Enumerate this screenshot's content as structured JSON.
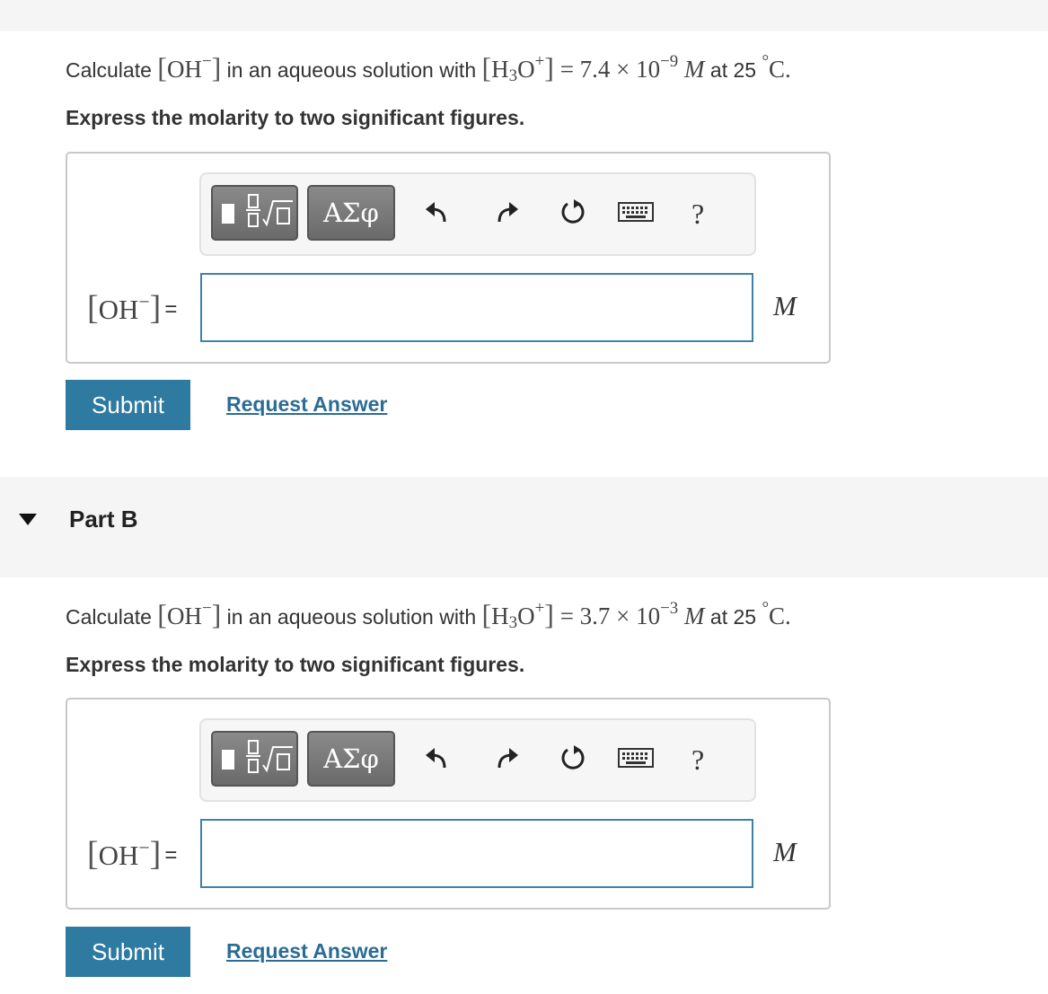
{
  "partA": {
    "question": {
      "prefix": "Calculate",
      "species": "OH",
      "middle": "in an aqueous solution with",
      "acid_h": "H",
      "acid_sub": "3",
      "acid_o": "O",
      "equals": "=",
      "mantissa": "7.4",
      "times": "×",
      "base": "10",
      "exponent": "−9",
      "molar": "M",
      "at": "at 25",
      "degree": "°",
      "celsius": "C."
    },
    "instruction": "Express the molarity to two significant figures.",
    "answer_label": "OH",
    "answer_equals": "=",
    "answer_value": "",
    "unit": "M",
    "submit_label": "Submit",
    "request_label": "Request Answer"
  },
  "partB": {
    "title": "Part B",
    "question": {
      "prefix": "Calculate",
      "species": "OH",
      "middle": "in an aqueous solution with",
      "acid_h": "H",
      "acid_sub": "3",
      "acid_o": "O",
      "equals": "=",
      "mantissa": "3.7",
      "times": "×",
      "base": "10",
      "exponent": "−3",
      "molar": "M",
      "at": "at 25",
      "degree": "°",
      "celsius": "C."
    },
    "instruction": "Express the molarity to two significant figures.",
    "answer_label": "OH",
    "answer_equals": "=",
    "answer_value": "",
    "unit": "M",
    "submit_label": "Submit",
    "request_label": "Request Answer"
  },
  "toolbar": {
    "greek_label": "ΑΣφ",
    "help_label": "?",
    "icons": [
      "templates-icon",
      "greek-symbols-icon",
      "undo-icon",
      "redo-icon",
      "reset-icon",
      "keyboard-icon",
      "help-icon"
    ]
  },
  "colors": {
    "accent": "#2f7aa0",
    "link": "#2b6c96",
    "input_border": "#3e82a8",
    "band": "#f5f5f5"
  }
}
